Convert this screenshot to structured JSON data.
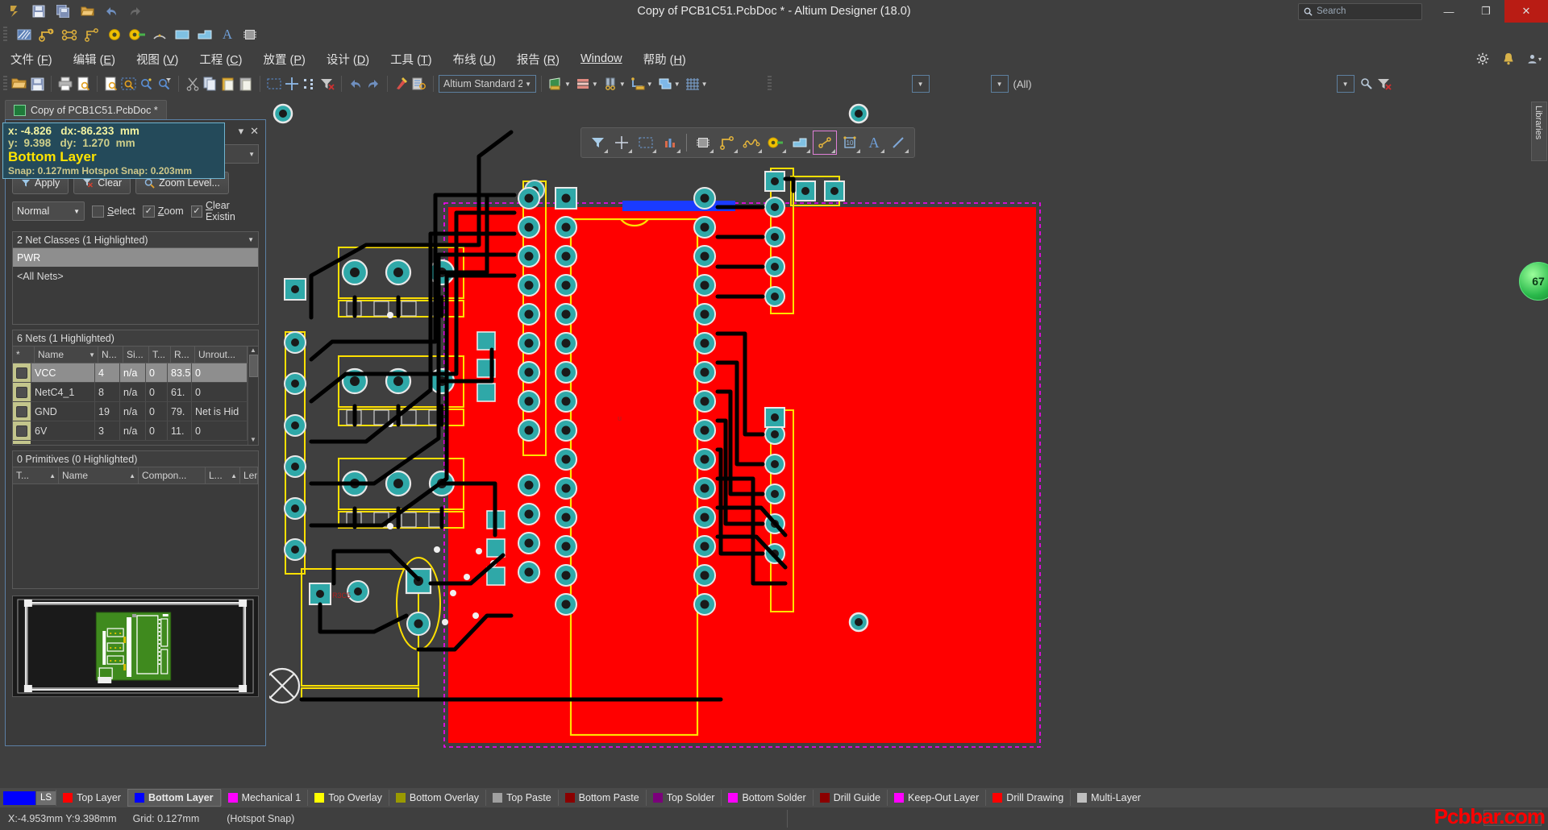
{
  "window": {
    "title": "Copy of PCB1C51.PcbDoc * - Altium Designer (18.0)",
    "search_placeholder": "Search",
    "minimize": "—",
    "restore": "❐",
    "close": "✕"
  },
  "quick_toolbar": [
    {
      "name": "altium-logo-icon",
      "glyph": "Ⓐ"
    },
    {
      "name": "save-icon",
      "glyph": "💾"
    },
    {
      "name": "save-all-icon",
      "glyph": "🖫"
    },
    {
      "name": "open-icon",
      "glyph": "📂"
    },
    {
      "name": "undo-icon",
      "glyph": "↩"
    },
    {
      "name": "redo-icon",
      "glyph": "↪"
    }
  ],
  "quick_toolbar2": [
    {
      "name": "polygon-pour-icon"
    },
    {
      "name": "route-track-icon"
    },
    {
      "name": "differential-pair-icon"
    },
    {
      "name": "interactive-length-tune-icon"
    },
    {
      "name": "pad-icon"
    },
    {
      "name": "via-icon"
    },
    {
      "name": "arc-icon"
    },
    {
      "name": "fill-icon"
    },
    {
      "name": "region-icon"
    },
    {
      "name": "string-icon"
    },
    {
      "name": "component-icon"
    }
  ],
  "menu": [
    {
      "label": "文件",
      "accel": "F"
    },
    {
      "label": "编辑",
      "accel": "E"
    },
    {
      "label": "视图",
      "accel": "V"
    },
    {
      "label": "工程",
      "accel": "C"
    },
    {
      "label": "放置",
      "accel": "P"
    },
    {
      "label": "设计",
      "accel": "D"
    },
    {
      "label": "工具",
      "accel": "T"
    },
    {
      "label": "布线",
      "accel": "U"
    },
    {
      "label": "报告",
      "accel": "R"
    },
    {
      "label": "Window",
      "accel": ""
    },
    {
      "label": "帮助",
      "accel": "H"
    }
  ],
  "menubar_right": [
    {
      "name": "settings-gear-icon",
      "glyph": "⚙"
    },
    {
      "name": "notifications-bell-icon",
      "glyph": "🔔"
    },
    {
      "name": "user-account-icon",
      "glyph": "👤"
    }
  ],
  "toolbar2": {
    "style_combo_value": "Altium Standard 2",
    "filter_all_value": "(All)",
    "icons": [
      {
        "name": "open-document-icon"
      },
      {
        "name": "save-document-icon"
      },
      {
        "name": "print-icon"
      },
      {
        "name": "print-preview-icon"
      },
      {
        "name": "zoom-document-icon"
      },
      {
        "name": "zoom-area-icon"
      },
      {
        "name": "zoom-selected-icon"
      },
      {
        "name": "zoom-filter-icon"
      },
      {
        "name": "cut-icon"
      },
      {
        "name": "copy-icon"
      },
      {
        "name": "paste-icon"
      },
      {
        "name": "paste-special-icon"
      },
      {
        "name": "select-area-icon"
      },
      {
        "name": "move-icon"
      },
      {
        "name": "align-icon"
      },
      {
        "name": "clear-filter-icon"
      },
      {
        "name": "undo-icon"
      },
      {
        "name": "redo-icon"
      },
      {
        "name": "cross-probe-icon"
      },
      {
        "name": "browse-components-icon"
      },
      {
        "name": "layers-stack-icon"
      },
      {
        "name": "board-layers-icon"
      },
      {
        "name": "design-rules-icon"
      },
      {
        "name": "measure-icon"
      },
      {
        "name": "layer-sets-icon"
      },
      {
        "name": "grid-icon"
      },
      {
        "name": "zoom-find-icon"
      },
      {
        "name": "filter-icon"
      }
    ]
  },
  "document_tab": {
    "label": "Copy of PCB1C51.PcbDoc *",
    "icon": "pcb-document-icon"
  },
  "coordinate_readout": {
    "line1": "x: -4.826   dx:-86.233  mm",
    "line2": "y:  9.398   dy:  1.270  mm",
    "layer": "Bottom Layer",
    "snap": "Snap: 0.127mm Hotspot Snap: 0.203mm"
  },
  "panel": {
    "header_buttons": [
      {
        "name": "panel-dropdown-icon",
        "glyph": "▾"
      },
      {
        "name": "panel-close-icon",
        "glyph": "✕"
      }
    ],
    "doc_selector_value": "",
    "buttons": [
      {
        "name": "apply-button",
        "label": "Apply",
        "icon": "filter-icon"
      },
      {
        "name": "clear-button",
        "label": "Clear",
        "icon": "clear-filter-icon"
      },
      {
        "name": "zoom-level-button",
        "label": "Zoom Level...",
        "icon": "magnifier-icon"
      }
    ],
    "mode_select": "Normal",
    "checkboxes": [
      {
        "name": "select-checkbox",
        "label": "Select",
        "checked": false
      },
      {
        "name": "zoom-checkbox",
        "label": "Zoom",
        "checked": true
      },
      {
        "name": "clear-existing-checkbox",
        "label": "Clear Existin",
        "checked": true
      }
    ],
    "net_classes": {
      "title": "2 Net Classes (1 Highlighted)",
      "items": [
        "PWR",
        "<All Nets>"
      ],
      "selected_index": 0
    },
    "nets": {
      "title": "6 Nets (1 Highlighted)",
      "columns": [
        "*",
        "Name",
        "N...",
        "Si...",
        "T...",
        "R...",
        "Unrout..."
      ],
      "rows": [
        {
          "name": "VCC",
          "n": "4",
          "si": "n/a",
          "t": "0",
          "r": "83.5",
          "unrouted": "0",
          "selected": true
        },
        {
          "name": "NetC4_1",
          "n": "8",
          "si": "n/a",
          "t": "0",
          "r": "61.",
          "unrouted": "0",
          "selected": false
        },
        {
          "name": "GND",
          "n": "19",
          "si": "n/a",
          "t": "0",
          "r": "79.",
          "unrouted": "Net is Hid",
          "selected": false
        },
        {
          "name": "6V",
          "n": "3",
          "si": "n/a",
          "t": "0",
          "r": "11.",
          "unrouted": "0",
          "selected": false
        }
      ]
    },
    "primitives": {
      "title": "0 Primitives (0 Highlighted)",
      "columns": [
        "T...",
        "Name",
        "Compon...",
        "L...",
        "Length"
      ],
      "rows": []
    }
  },
  "canvas_toolbar": [
    {
      "name": "filter-tool-icon"
    },
    {
      "name": "crosshair-tool-icon"
    },
    {
      "name": "selection-box-tool-icon"
    },
    {
      "name": "board-insight-tool-icon"
    },
    {
      "name": "component-tool-icon"
    },
    {
      "name": "interactive-routing-tool-icon"
    },
    {
      "name": "differential-pair-routing-tool-icon"
    },
    {
      "name": "pad-tool-icon"
    },
    {
      "name": "fill-tool-icon"
    },
    {
      "name": "dimension-tool-icon"
    },
    {
      "name": "coordinate-tool-icon"
    },
    {
      "name": "string-tool-icon"
    },
    {
      "name": "line-tool-icon"
    }
  ],
  "right_rail": {
    "libraries_tab": "Libraries",
    "heads_up_value": "67"
  },
  "layer_bar": {
    "ls_label": "LS",
    "ls_color": "#0000ff",
    "layers": [
      {
        "label": "Top Layer",
        "color": "#ff0000",
        "active": false
      },
      {
        "label": "Bottom Layer",
        "color": "#0000ff",
        "active": true
      },
      {
        "label": "Mechanical 1",
        "color": "#ff00ff",
        "active": false
      },
      {
        "label": "Top Overlay",
        "color": "#ffff00",
        "active": false
      },
      {
        "label": "Bottom Overlay",
        "color": "#9a9a00",
        "active": false
      },
      {
        "label": "Top Paste",
        "color": "#a0a0a0",
        "active": false
      },
      {
        "label": "Bottom Paste",
        "color": "#8b0000",
        "active": false
      },
      {
        "label": "Top Solder",
        "color": "#7b007b",
        "active": false
      },
      {
        "label": "Bottom Solder",
        "color": "#ff00ff",
        "active": false
      },
      {
        "label": "Drill Guide",
        "color": "#8b0000",
        "active": false
      },
      {
        "label": "Keep-Out Layer",
        "color": "#ff00ff",
        "active": false
      },
      {
        "label": "Drill Drawing",
        "color": "#ff0000",
        "active": false
      },
      {
        "label": "Multi-Layer",
        "color": "#bfbfbf",
        "active": false
      }
    ]
  },
  "status_bar": {
    "coords": "X:-4.953mm Y:9.398mm",
    "grid": "Grid: 0.127mm",
    "snap_mode": "(Hotspot Snap)",
    "watermark": "Pcbbar.com"
  }
}
